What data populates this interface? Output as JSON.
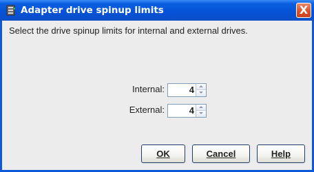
{
  "window": {
    "title": "Adapter drive spinup limits",
    "close_label": "X"
  },
  "instruction": "Select the drive spinup limits for internal and external drives.",
  "fields": [
    {
      "label": "Internal:",
      "value": "4"
    },
    {
      "label": "External:",
      "value": "4"
    }
  ],
  "buttons": {
    "ok": "OK",
    "cancel": "Cancel",
    "help": "Help"
  },
  "colors": {
    "titlebar": "#0552d6",
    "border": "#0b58d8",
    "background": "#ececec",
    "close": "#d9532d"
  }
}
